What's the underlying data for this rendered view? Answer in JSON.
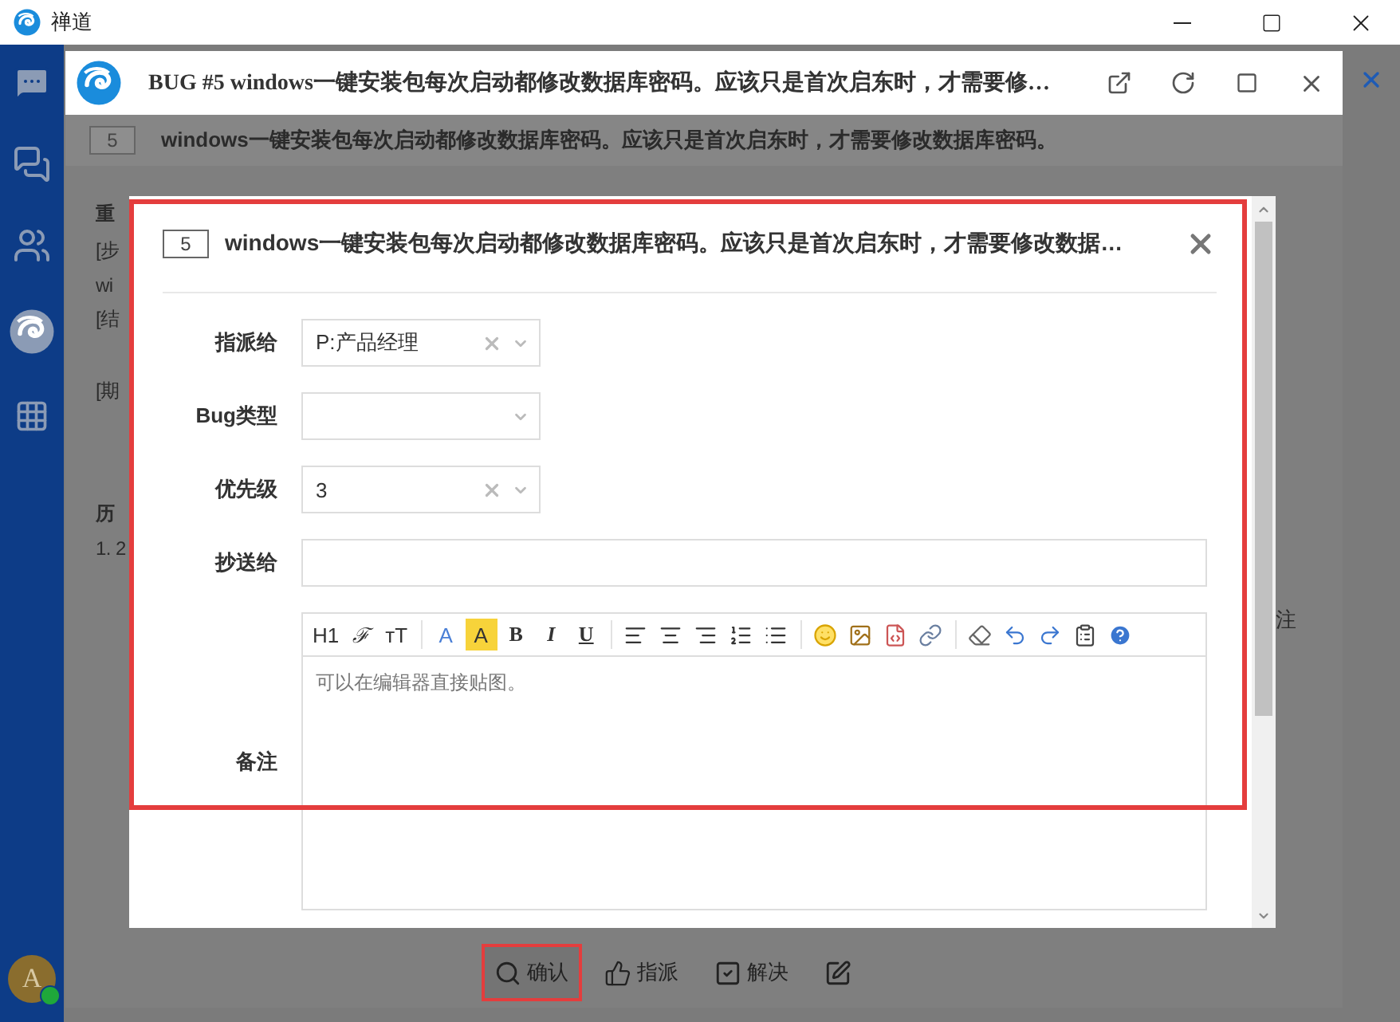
{
  "app": {
    "title": "禅道"
  },
  "sidebar": {
    "avatar": "A",
    "online": true
  },
  "bug_window": {
    "title": "BUG #5 windows一键安装包每次启动都修改数据库密码。应该只是首次启东时，才需要修…"
  },
  "background": {
    "id_badge": "5",
    "summary": "windows一键安装包每次启动都修改数据库密码。应该只是首次启东时，才需要修改数据库密码。",
    "fragments": [
      {
        "kind": "heading",
        "text": "重"
      },
      {
        "kind": "line",
        "text": "[步"
      },
      {
        "kind": "line",
        "text": "wi"
      },
      {
        "kind": "line",
        "text": "[结"
      },
      {
        "kind": "gapline",
        "text": "[期"
      },
      {
        "kind": "section",
        "text": "历"
      },
      {
        "kind": "line",
        "text": "1. 2"
      }
    ],
    "side_label": "注"
  },
  "dialog": {
    "id_badge": "5",
    "title": "windows一键安装包每次启动都修改数据库密码。应该只是首次启东时，才需要修改数据…",
    "fields": [
      {
        "kind": "select",
        "label": "指派给",
        "value": "P:产品经理",
        "clearable": true
      },
      {
        "kind": "select",
        "label": "Bug类型",
        "clearable": false
      },
      {
        "kind": "select",
        "label": "优先级",
        "value": "3",
        "clearable": true
      },
      {
        "kind": "input",
        "label": "抄送给"
      },
      {
        "kind": "editor",
        "label": "备注",
        "placeholder": "可以在编辑器直接贴图。"
      }
    ],
    "toolbar": [
      {
        "kind": "heading",
        "label": "H1"
      },
      {
        "kind": "font",
        "label": "ℱ"
      },
      {
        "kind": "size",
        "label": "тT"
      },
      {
        "kind": "sep"
      },
      {
        "kind": "color",
        "label": "A"
      },
      {
        "kind": "highlight",
        "label": "A"
      },
      {
        "kind": "bold",
        "label": "B"
      },
      {
        "kind": "italic",
        "label": "I"
      },
      {
        "kind": "underline",
        "label": "U"
      },
      {
        "kind": "sep"
      },
      {
        "kind": "alignleft"
      },
      {
        "kind": "aligncenter"
      },
      {
        "kind": "alignright"
      },
      {
        "kind": "ordered"
      },
      {
        "kind": "bullets"
      },
      {
        "kind": "sep"
      },
      {
        "kind": "emoji"
      },
      {
        "kind": "image"
      },
      {
        "kind": "code"
      },
      {
        "kind": "link"
      },
      {
        "kind": "sep"
      },
      {
        "kind": "eraser"
      },
      {
        "kind": "undo"
      },
      {
        "kind": "redo"
      },
      {
        "kind": "paste"
      },
      {
        "kind": "help"
      }
    ]
  },
  "actions": [
    {
      "kind": "confirm",
      "label": "确认",
      "highlighted": true
    },
    {
      "kind": "assign",
      "label": "指派",
      "highlighted": false
    },
    {
      "kind": "resolve",
      "label": "解决",
      "highlighted": false
    },
    {
      "kind": "edit",
      "highlighted": false
    }
  ]
}
